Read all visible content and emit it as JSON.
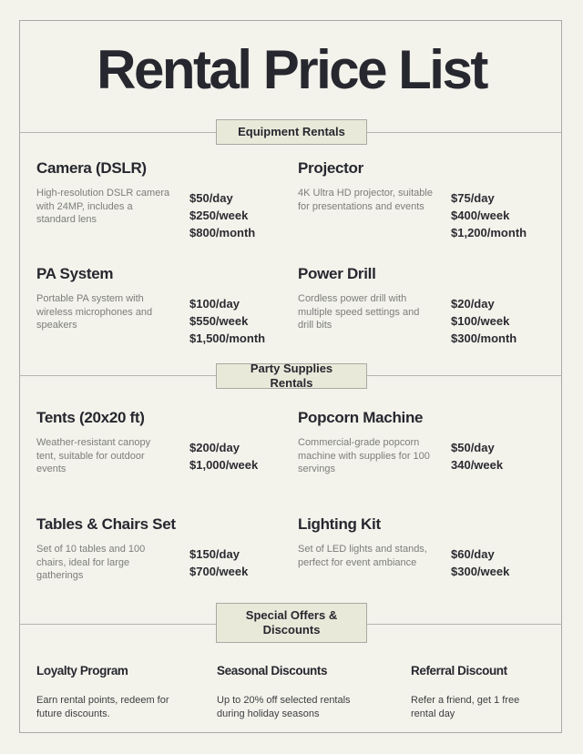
{
  "title": "Rental Price List",
  "sections": [
    {
      "label": "Equipment Rentals",
      "items": [
        {
          "name": "Camera (DSLR)",
          "description": "High-resolution DSLR camera with 24MP, includes a standard lens",
          "prices": [
            "$50/day",
            "$250/week",
            "$800/month"
          ]
        },
        {
          "name": "Projector",
          "description": "4K Ultra HD projector, suitable for presentations and events",
          "prices": [
            "$75/day",
            "$400/week",
            "$1,200/month"
          ]
        },
        {
          "name": "PA System",
          "description": "Portable PA system with wireless microphones and speakers",
          "prices": [
            "$100/day",
            "$550/week",
            "$1,500/month"
          ]
        },
        {
          "name": "Power Drill",
          "description": "Cordless power drill with multiple speed settings and drill bits",
          "prices": [
            "$20/day",
            "$100/week",
            "$300/month"
          ]
        }
      ]
    },
    {
      "label": "Party Supplies Rentals",
      "items": [
        {
          "name": "Tents (20x20 ft)",
          "description": "Weather-resistant canopy tent, suitable for outdoor events",
          "prices": [
            "$200/day",
            "$1,000/week"
          ]
        },
        {
          "name": "Popcorn Machine",
          "description": "Commercial-grade popcorn machine with supplies for 100 servings",
          "prices": [
            "$50/day",
            "340/week"
          ]
        },
        {
          "name": "Tables & Chairs Set",
          "description": "Set of 10 tables and 100 chairs, ideal for large gatherings",
          "prices": [
            "$150/day",
            "$700/week"
          ]
        },
        {
          "name": "Lighting Kit",
          "description": "Set of LED lights and stands, perfect for event ambiance",
          "prices": [
            "$60/day",
            "$300/week"
          ]
        }
      ]
    },
    {
      "label": "Special Offers & Discounts",
      "offers": [
        {
          "name": "Loyalty Program",
          "description": "Earn rental points, redeem for future discounts."
        },
        {
          "name": "Seasonal Discounts",
          "description": "Up to 20% off selected rentals during holiday seasons"
        },
        {
          "name": "Referral Discount",
          "description": "Refer a friend, get 1 free rental day"
        }
      ]
    }
  ]
}
